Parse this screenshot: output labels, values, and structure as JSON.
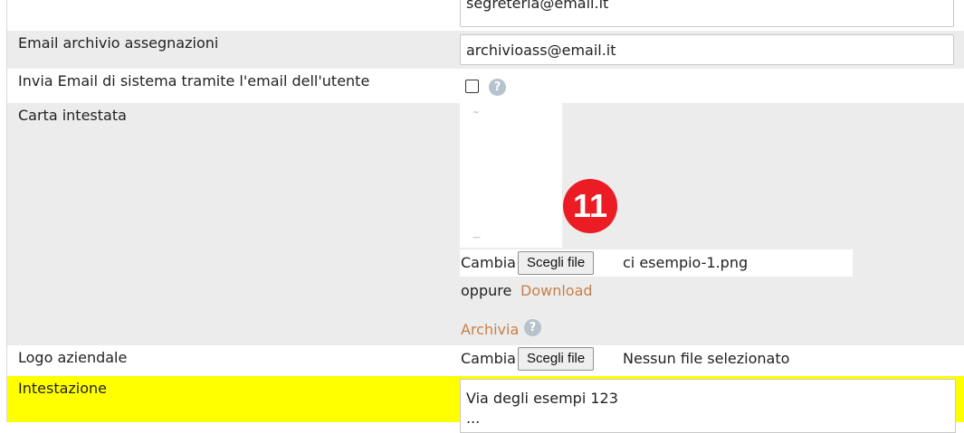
{
  "rows": {
    "segreteria": {
      "value": "segreteria@email.it"
    },
    "email_archivio": {
      "label": "Email archivio assegnazioni",
      "value": "archivioass@email.it"
    },
    "invia_email": {
      "label": "Invia Email di sistema tramite l'email dell'utente",
      "checked": false,
      "help": "?"
    },
    "carta_intestata": {
      "label": "Carta intestata",
      "change_label": "Cambia",
      "button_label": "Scegli file",
      "file_name": "ci esempio-1.png",
      "or_label": "oppure",
      "download_link": "Download",
      "archive_link": "Archivia",
      "help": "?"
    },
    "logo_aziendale": {
      "label": "Logo aziendale",
      "change_label": "Cambia",
      "button_label": "Scegli file",
      "file_name": "Nessun file selezionato"
    },
    "intestazione": {
      "label": "Intestazione",
      "value_line1": "Via degli esempi 123",
      "value_line2": "..."
    }
  },
  "annotation": {
    "number": "11",
    "color": "#ec1c24"
  },
  "colors": {
    "row_gray": "#ececec",
    "highlight": "#ffff00",
    "link": "#c6804a"
  }
}
